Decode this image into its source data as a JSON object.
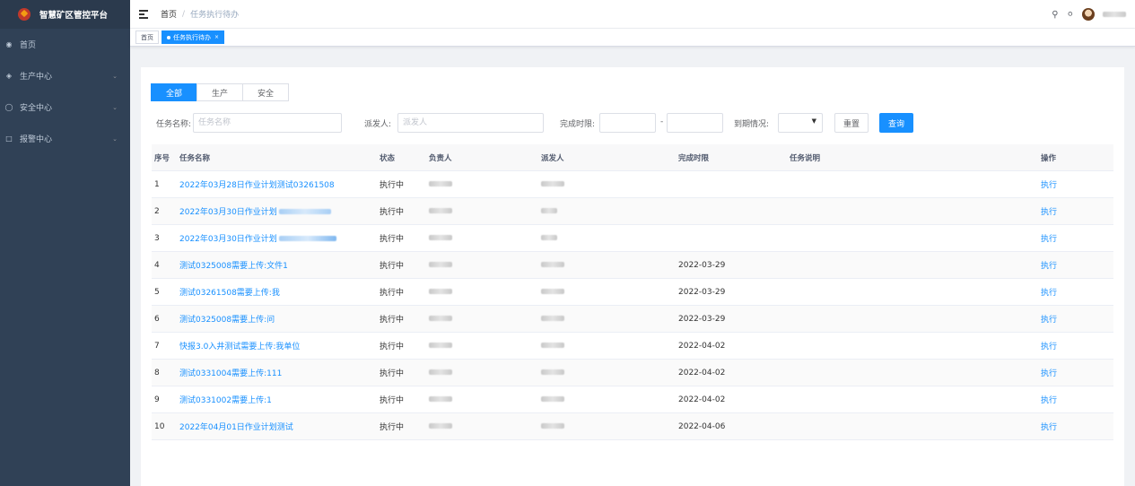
{
  "app": {
    "title": "智慧矿区管控平台"
  },
  "sidebar": {
    "items": [
      {
        "label": "首页",
        "icon": "dashboard-icon",
        "arrow": false
      },
      {
        "label": "生产中心",
        "icon": "layers-icon",
        "arrow": true
      },
      {
        "label": "安全中心",
        "icon": "shield-icon",
        "arrow": true
      },
      {
        "label": "报警中心",
        "icon": "alarm-icon",
        "arrow": true
      }
    ]
  },
  "header": {
    "breadcrumb": [
      "首页",
      "任务执行待办"
    ],
    "separator": "/"
  },
  "tags": [
    {
      "label": "首页",
      "active": false
    },
    {
      "label": "任务执行待办",
      "active": true
    }
  ],
  "segments": [
    "全部",
    "生产",
    "安全"
  ],
  "filters": {
    "task_name_label": "任务名称:",
    "task_name_placeholder": "任务名称",
    "dispatcher_label": "派发人:",
    "dispatcher_placeholder": "派发人",
    "deadline_label": "完成时限:",
    "range_separator": "-",
    "due_label": "到期情况:",
    "reset": "重置",
    "query": "查询"
  },
  "table": {
    "columns": [
      "序号",
      "任务名称",
      "状态",
      "负责人",
      "派发人",
      "完成时限",
      "任务说明",
      "操作"
    ],
    "rows": [
      {
        "no": "1",
        "name": "2022年03月28日作业计划测试03261508",
        "status": "执行中",
        "deadline": "",
        "desc": "",
        "action": "执行"
      },
      {
        "no": "2",
        "name": "2022年03月30日作业计划",
        "status": "执行中",
        "deadline": "",
        "desc": "",
        "action": "执行"
      },
      {
        "no": "3",
        "name": "2022年03月30日作业计划",
        "status": "执行中",
        "deadline": "",
        "desc": "",
        "action": "执行"
      },
      {
        "no": "4",
        "name": "测试0325008需要上传:文件1",
        "status": "执行中",
        "deadline": "2022-03-29",
        "desc": "",
        "action": "执行"
      },
      {
        "no": "5",
        "name": "测试03261508需要上传:我",
        "status": "执行中",
        "deadline": "2022-03-29",
        "desc": "",
        "action": "执行"
      },
      {
        "no": "6",
        "name": "测试0325008需要上传:问",
        "status": "执行中",
        "deadline": "2022-03-29",
        "desc": "",
        "action": "执行"
      },
      {
        "no": "7",
        "name": "快报3.0入井测试需要上传:我单位",
        "status": "执行中",
        "deadline": "2022-04-02",
        "desc": "",
        "action": "执行"
      },
      {
        "no": "8",
        "name": "测试0331004需要上传:111",
        "status": "执行中",
        "deadline": "2022-04-02",
        "desc": "",
        "action": "执行"
      },
      {
        "no": "9",
        "name": "测试0331002需要上传:1",
        "status": "执行中",
        "deadline": "2022-04-02",
        "desc": "",
        "action": "执行"
      },
      {
        "no": "10",
        "name": "2022年04月01日作业计划测试",
        "status": "执行中",
        "deadline": "2022-04-06",
        "desc": "",
        "action": "执行"
      }
    ]
  },
  "colors": {
    "accent": "#1890ff",
    "sidebar_bg": "#304156"
  }
}
